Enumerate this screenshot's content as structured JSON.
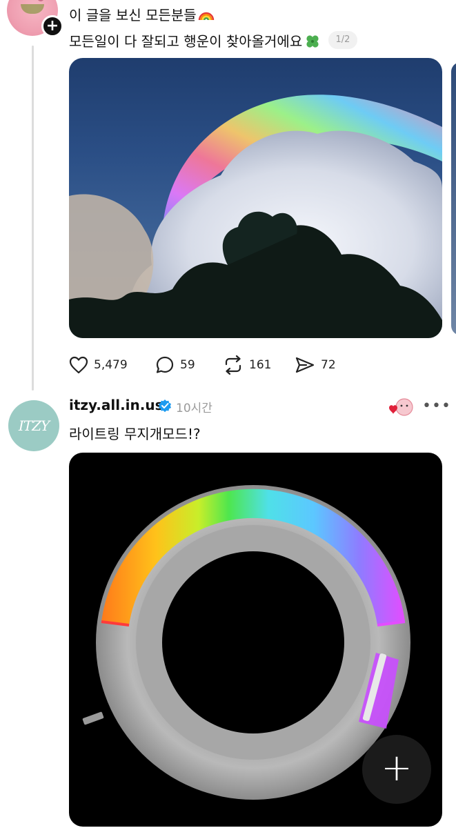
{
  "post1": {
    "line1": "이 글을 보신 모든분들",
    "line2": "모든일이 다 잘되고 행운이 찾아올거에요",
    "pager": "1/2",
    "likes": "5,479",
    "replies": "59",
    "reposts": "161",
    "shares": "72",
    "icons": [
      "rainbow-emoji",
      "clover-emoji",
      "heart-icon",
      "comment-icon",
      "repost-icon",
      "share-icon"
    ]
  },
  "post2": {
    "avatar_text": "ITZY",
    "username": "itzy.all.in.us",
    "time": "10시간",
    "caption": "라이트링 무지개모드!?",
    "more": "•••"
  },
  "fab_label": "+",
  "follow_label": "+"
}
